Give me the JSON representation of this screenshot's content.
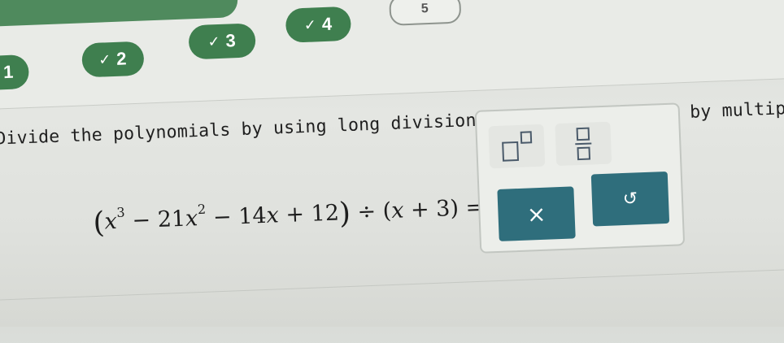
{
  "progress": {
    "items": [
      {
        "label": "1",
        "check": ""
      },
      {
        "label": "2",
        "check": "✓"
      },
      {
        "label": "3",
        "check": "✓"
      },
      {
        "label": "4",
        "check": "✓"
      }
    ],
    "next_label": "5",
    "completed_color": "#3f7f4f"
  },
  "question": {
    "text": "Divide the polynomials by using long division. Check your answer by multiplication."
  },
  "expression": {
    "open_paren": "(",
    "t1": "x",
    "e1": "3",
    "t2": " − 21",
    "t2x": "x",
    "e2": "2",
    "t3": " − 14",
    "t3x": "x",
    "t4": " + 12",
    "close_paren": ")",
    "divide": " ÷ (",
    "d1": "x",
    "d2": " + 3) = "
  },
  "tools": {
    "superscript_icon": "superscript-icon",
    "fraction_icon": "fraction-icon",
    "clear_label": "×",
    "undo_label": "↺",
    "button_color": "#2f6e7c"
  }
}
